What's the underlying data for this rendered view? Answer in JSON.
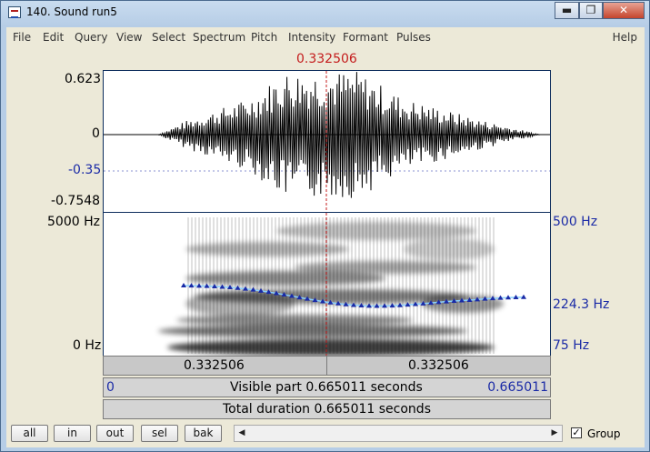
{
  "window": {
    "title": "140. Sound run5",
    "minimize": "▬",
    "maximize": "❐",
    "close": "✕"
  },
  "menu": [
    "File",
    "Edit",
    "Query",
    "View",
    "Select",
    "Spectrum",
    "Pitch",
    "Intensity",
    "Formant",
    "Pulses"
  ],
  "menu_help": "Help",
  "cursor_time": "0.332506",
  "waveform": {
    "ymax": "0.623",
    "zero": "0",
    "level_blue": "-0.35",
    "ymin": "-0.7548"
  },
  "spectrogram": {
    "freq_max": "5000 Hz",
    "freq_min": "0 Hz",
    "pitch_max": "500 Hz",
    "pitch_cur": "224.3 Hz",
    "pitch_min": "75 Hz"
  },
  "selection": {
    "left": "0.332506",
    "right": "0.332506"
  },
  "visible": {
    "start": "0",
    "label": "Visible part 0.665011 seconds",
    "end": "0.665011"
  },
  "total": "Total duration 0.665011 seconds",
  "buttons": [
    "all",
    "in",
    "out",
    "sel",
    "bak"
  ],
  "scroll": {
    "left": "◀",
    "right": "▶"
  },
  "group": {
    "checked": "✓",
    "label": "Group"
  },
  "colors": {
    "pitch": "#1a2aa6",
    "cursor": "#c41c1c"
  }
}
